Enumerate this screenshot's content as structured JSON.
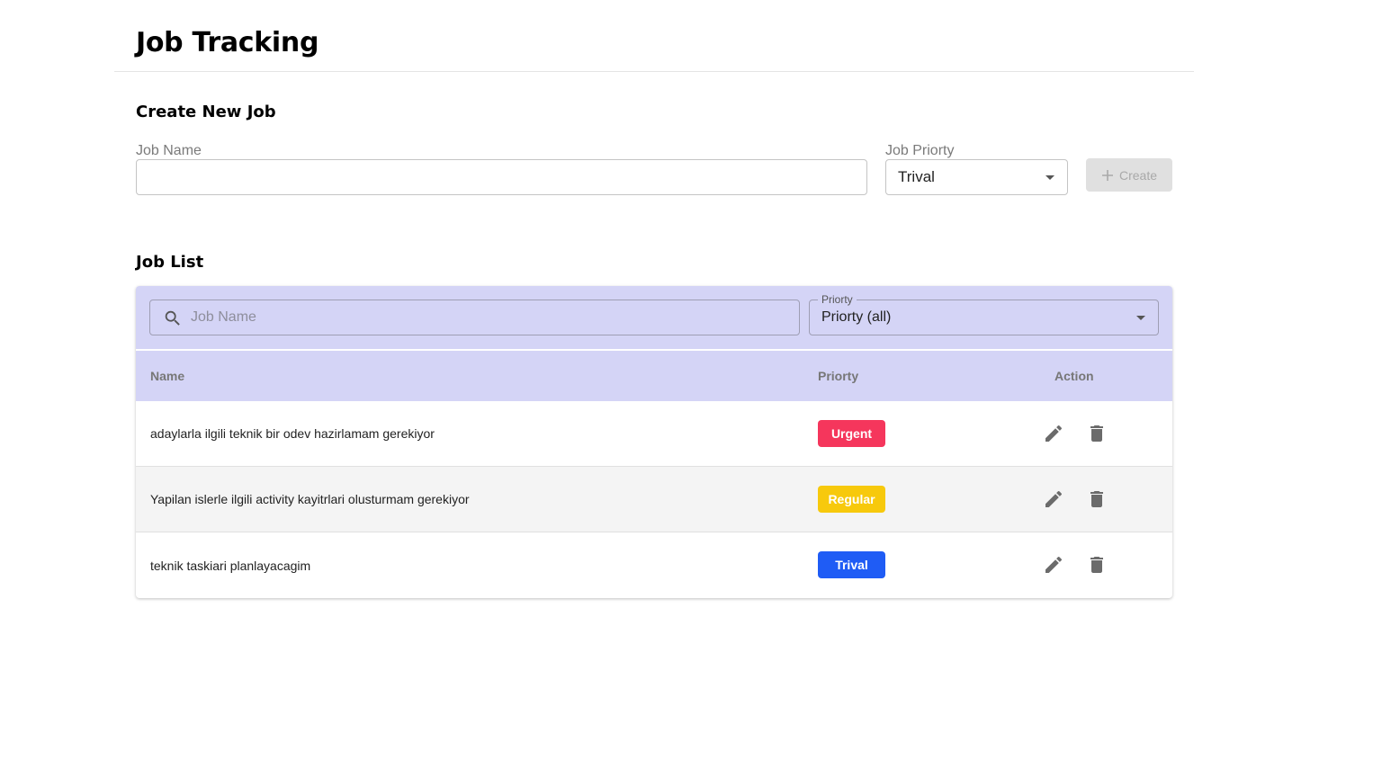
{
  "app": {
    "title": "Job Tracking"
  },
  "create_section": {
    "title": "Create New Job",
    "job_name_label": "Job Name",
    "job_name_value": "",
    "priority_label": "Job Priorty",
    "priority_value": "Trival",
    "create_button_label": "Create",
    "create_button_icon": "plus-icon",
    "create_button_enabled": false
  },
  "list_section": {
    "title": "Job List",
    "search_placeholder": "Job Name",
    "search_icon": "search-icon",
    "priority_filter_label": "Priorty",
    "priority_filter_value": "Priorty (all)",
    "columns": {
      "name": "Name",
      "priority": "Priorty",
      "action": "Action"
    },
    "rows": [
      {
        "name": "adaylarla ilgili teknik bir odev hazirlamam gerekiyor",
        "priority": "Urgent",
        "priority_color": "#f5365c"
      },
      {
        "name": "Yapilan islerle ilgili activity kayitrlari olusturmam gerekiyor",
        "priority": "Regular",
        "priority_color": "#f7c90c"
      },
      {
        "name": "teknik taskiari planlayacagim",
        "priority": "Trival",
        "priority_color": "#1f5cf5"
      }
    ]
  },
  "colors": {
    "table_header_bg": "#d4d4f6",
    "alt_row_bg": "#f4f4f4",
    "disabled_button_bg": "#e0e0e0",
    "icon_gray": "#6b6b6b"
  }
}
